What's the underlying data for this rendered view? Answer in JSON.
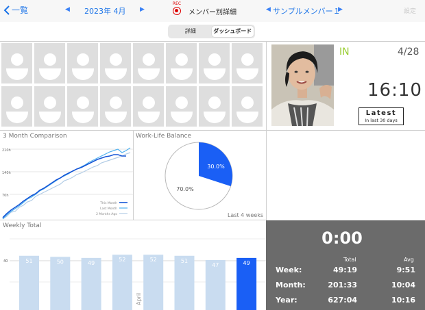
{
  "nav": {
    "back_label": "一覧",
    "month_label": "2023年 4月",
    "prev_arrow": "◀",
    "next_arrow": "▶",
    "rec_label": "REC",
    "title": "メンバー別詳細",
    "member_label": "サンプルメンバー１",
    "settings_label": "設定"
  },
  "segment": {
    "details_label": "詳細",
    "dashboard_label": "ダッシュボード",
    "selected": "ダッシュボード"
  },
  "attendance": {
    "status": "IN",
    "date": "4/28",
    "time": "16:10",
    "latest_title": "Latest",
    "latest_sub": "In last 30 days"
  },
  "comparison_chart": {
    "title": "3 Month Comparison",
    "y_ticks": [
      "210h",
      "140h",
      "70h"
    ],
    "legend": [
      {
        "label": "This Month",
        "color": "#1756d6"
      },
      {
        "label": "Last Month",
        "color": "#4fb1f0"
      },
      {
        "label": "2 Months Ago",
        "color": "#b3cde6"
      }
    ]
  },
  "balance_chart": {
    "title": "Work-Life Balance",
    "footer": "Last 4 weeks",
    "slices": [
      {
        "label": "30.0%",
        "value": 30.0,
        "color": "#1a5ff5"
      },
      {
        "label": "70.0%",
        "value": 70.0,
        "color": "#ffffff"
      }
    ]
  },
  "weekly_chart": {
    "title": "Weekly Total",
    "y_tick": "40",
    "month_label": "April"
  },
  "chart_data": {
    "type": "bar",
    "title": "Weekly Total",
    "values": [
      51,
      50,
      49,
      52,
      52,
      51,
      47,
      49
    ],
    "bar_labels": [
      "51",
      "50",
      "49",
      "52",
      "52",
      "51",
      "47",
      "49"
    ],
    "ylim": [
      0,
      56
    ],
    "highlight_index": 7,
    "colors": {
      "normal": "#c9dcf0",
      "highlight": "#1a5ff5"
    }
  },
  "totals": {
    "today": "0:00",
    "total_header": "Total",
    "avg_header": "Avg",
    "rows": [
      {
        "label": "Week:",
        "total": "49:19",
        "avg": "9:51"
      },
      {
        "label": "Month:",
        "total": "201:33",
        "avg": "10:04"
      },
      {
        "label": "Year:",
        "total": "627:04",
        "avg": "10:16"
      }
    ]
  }
}
